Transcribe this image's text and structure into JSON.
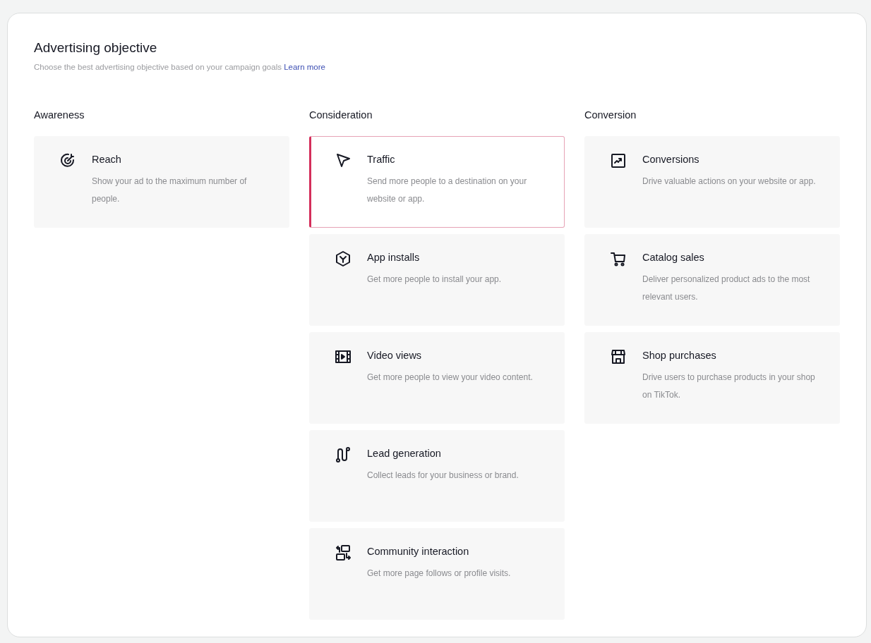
{
  "title": "Advertising objective",
  "subtitle": "Choose the best advertising objective based on your campaign goals",
  "learn_more": "Learn more",
  "columns": [
    {
      "heading": "Awareness",
      "objectives": [
        {
          "title": "Reach",
          "description": "Show your ad to the maximum number of people.",
          "selected": false
        }
      ]
    },
    {
      "heading": "Consideration",
      "objectives": [
        {
          "title": "Traffic",
          "description": "Send more people to a destination on your website or app.",
          "selected": true
        },
        {
          "title": "App installs",
          "description": "Get more people to install your app.",
          "selected": false
        },
        {
          "title": "Video views",
          "description": "Get more people to view your video content.",
          "selected": false
        },
        {
          "title": "Lead generation",
          "description": "Collect leads for your business or brand.",
          "selected": false
        },
        {
          "title": "Community interaction",
          "description": "Get more page follows or profile visits.",
          "selected": false
        }
      ]
    },
    {
      "heading": "Conversion",
      "objectives": [
        {
          "title": "Conversions",
          "description": "Drive valuable actions on your website or app.",
          "selected": false
        },
        {
          "title": "Catalog sales",
          "description": "Deliver personalized product ads to the most relevant users.",
          "selected": false
        },
        {
          "title": "Shop purchases",
          "description": "Drive users to purchase products in your shop on TikTok.",
          "selected": false
        }
      ]
    }
  ]
}
